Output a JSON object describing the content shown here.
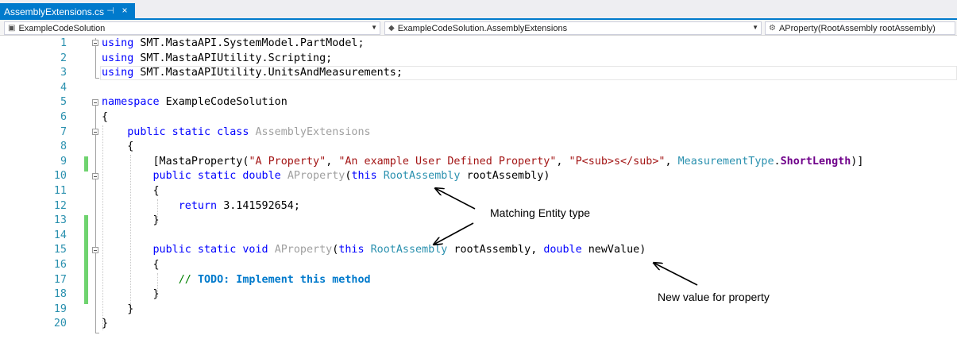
{
  "tab": {
    "title": "AssemblyExtensions.cs",
    "pin_icon": "pin-icon",
    "close_icon": "close-icon"
  },
  "navbar": {
    "project": "ExampleCodeSolution",
    "type": "ExampleCodeSolution.AssemblyExtensions",
    "member": "AProperty(RootAssembly rootAssembly)"
  },
  "code": {
    "line_numbers": [
      "1",
      "2",
      "3",
      "4",
      "5",
      "6",
      "7",
      "8",
      "9",
      "10",
      "11",
      "12",
      "13",
      "14",
      "15",
      "16",
      "17",
      "18",
      "19",
      "20"
    ],
    "using_kw": "using",
    "using1": "SMT.MastaAPI.SystemModel.PartModel;",
    "using2": "SMT.MastaAPIUtility.Scripting;",
    "using3": "SMT.MastaAPIUtility.UnitsAndMeasurements;",
    "namespace_kw": "namespace",
    "namespace_name": "ExampleCodeSolution",
    "open_brace": "{",
    "close_brace": "}",
    "class_mods": "public static class",
    "class_name": "AssemblyExtensions",
    "attr_open": "[MastaProperty(",
    "attr_str1": "\"A Property\"",
    "attr_str2": "\"An example User Defined Property\"",
    "attr_str3": "\"P<sub>s</sub>\"",
    "comma": ", ",
    "attr_enum_type": "MeasurementType",
    "attr_dot": ".",
    "attr_enum_val": "ShortLength",
    "attr_close": ")]",
    "getter_mods": "public static double",
    "prop_name": "AProperty",
    "paren_open": "(",
    "this_kw": "this",
    "root_type": "RootAssembly",
    "root_param": "rootAssembly",
    "paren_close": ")",
    "return_kw": "return",
    "return_val": "3.141592654;",
    "setter_mods": "public static void",
    "double_kw": "double",
    "new_param": "newValue",
    "comment_slashes": "// ",
    "comment_todo": "TODO: Implement this method"
  },
  "annotations": {
    "entity": "Matching Entity type",
    "newvalue": "New value for property"
  },
  "colors": {
    "accent": "#007acc",
    "keyword": "#0000ff",
    "string": "#a31515",
    "type": "#2b91af",
    "comment": "#008000",
    "change_bar": "#6fd36f"
  }
}
